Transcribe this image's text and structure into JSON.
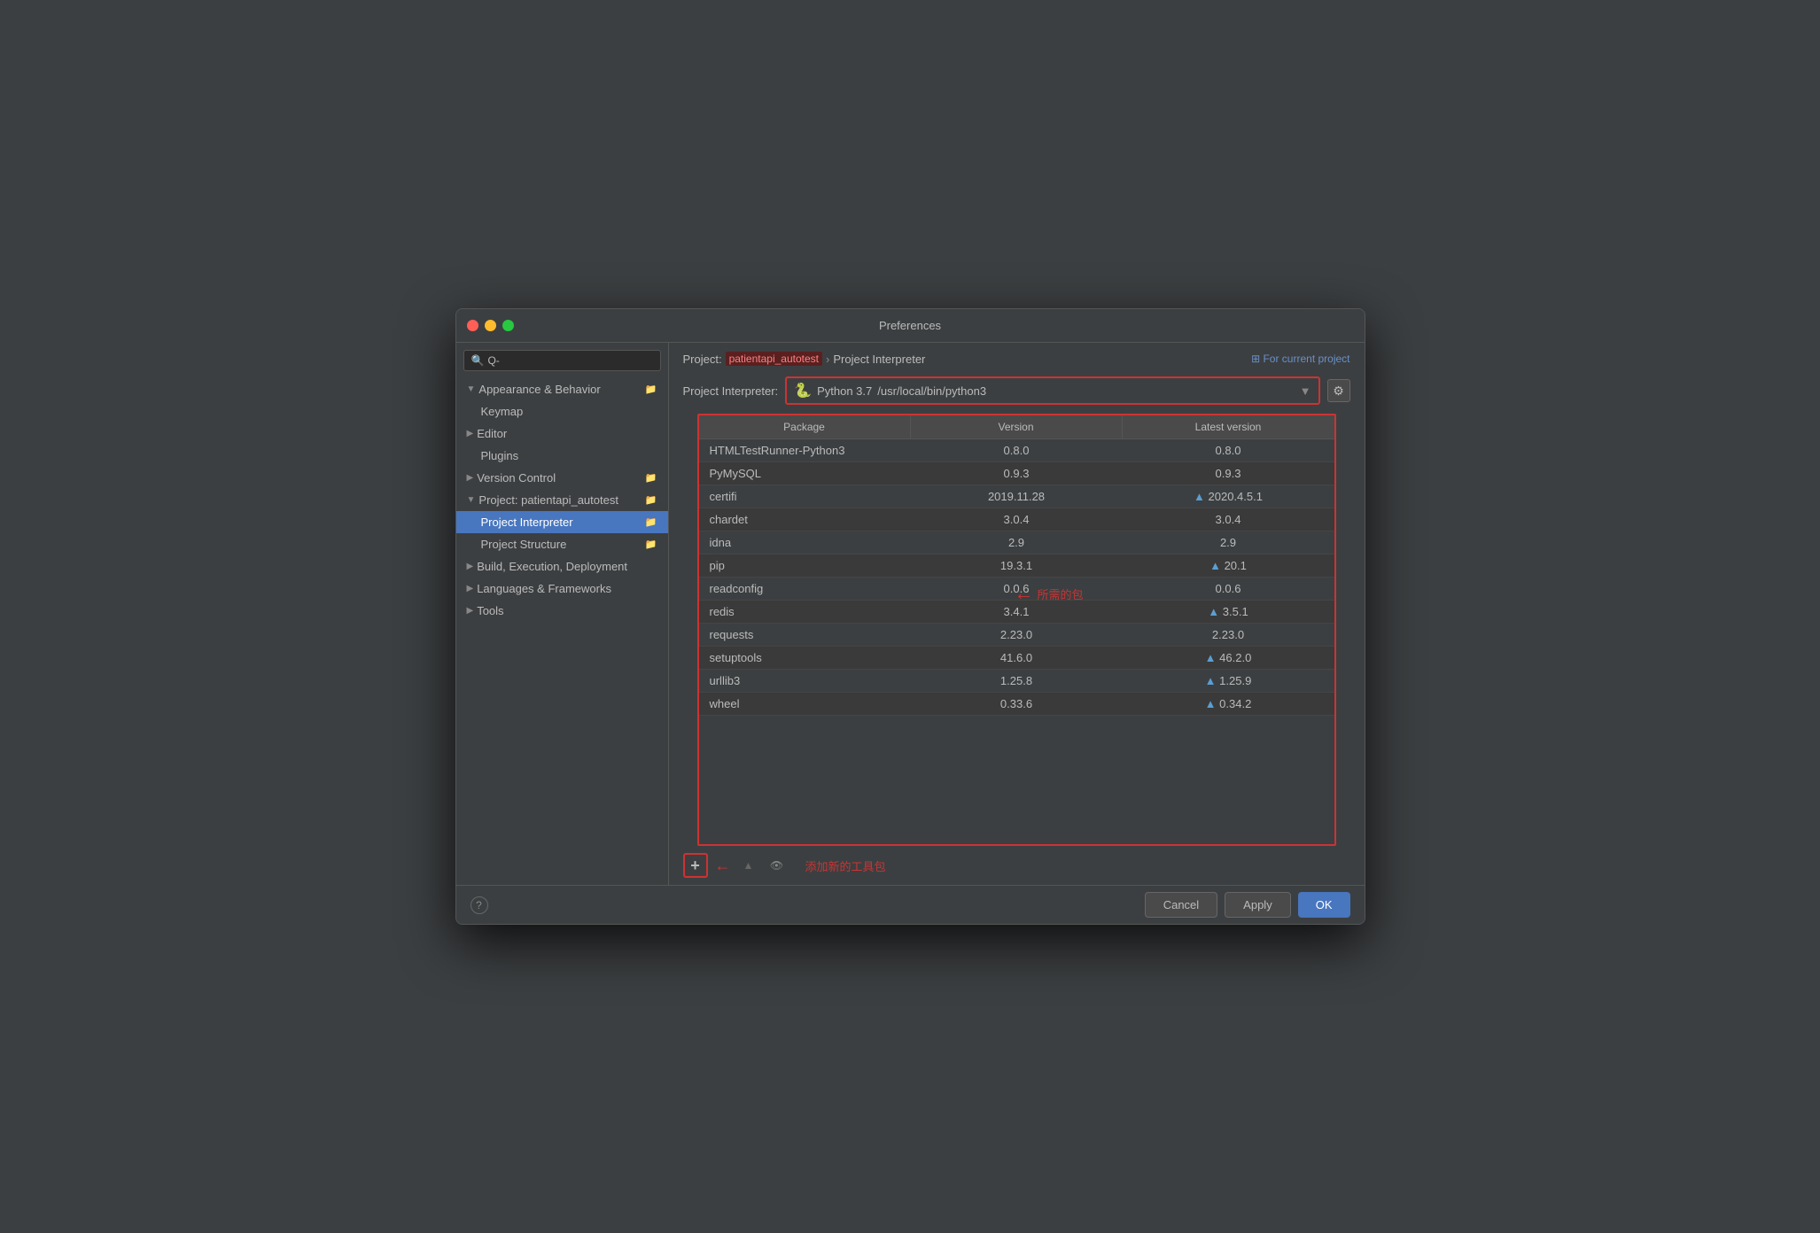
{
  "window": {
    "title": "Preferences"
  },
  "sidebar": {
    "search_placeholder": "Q-",
    "items": [
      {
        "id": "appearance-behavior",
        "label": "Appearance & Behavior",
        "level": 0,
        "expandable": true,
        "expanded": true
      },
      {
        "id": "keymap",
        "label": "Keymap",
        "level": 1
      },
      {
        "id": "editor",
        "label": "Editor",
        "level": 0,
        "expandable": true
      },
      {
        "id": "plugins",
        "label": "Plugins",
        "level": 1
      },
      {
        "id": "version-control",
        "label": "Version Control",
        "level": 0,
        "expandable": true
      },
      {
        "id": "project",
        "label": "Project: patientapi_autotest",
        "level": 0,
        "expandable": true,
        "expanded": true
      },
      {
        "id": "project-interpreter",
        "label": "Project Interpreter",
        "level": 1,
        "active": true
      },
      {
        "id": "project-structure",
        "label": "Project Structure",
        "level": 1
      },
      {
        "id": "build-execution",
        "label": "Build, Execution, Deployment",
        "level": 0,
        "expandable": true
      },
      {
        "id": "languages-frameworks",
        "label": "Languages & Frameworks",
        "level": 0,
        "expandable": true
      },
      {
        "id": "tools",
        "label": "Tools",
        "level": 0,
        "expandable": true
      }
    ]
  },
  "header": {
    "project_label": "Project:",
    "project_name": "patientapi_autotest",
    "arrow": "›",
    "page_title": "Project Interpreter",
    "for_current": "⊞ For current project"
  },
  "interpreter": {
    "label": "Project Interpreter:",
    "icon": "🐍",
    "version": "Python 3.7",
    "path": "/usr/local/bin/python3"
  },
  "table": {
    "columns": [
      "Package",
      "Version",
      "Latest version"
    ],
    "rows": [
      {
        "package": "HTMLTestRunner-Python3",
        "version": "0.8.0",
        "latest": "0.8.0",
        "upgrade": false
      },
      {
        "package": "PyMySQL",
        "version": "0.9.3",
        "latest": "0.9.3",
        "upgrade": false
      },
      {
        "package": "certifi",
        "version": "2019.11.28",
        "latest": "2020.4.5.1",
        "upgrade": true
      },
      {
        "package": "chardet",
        "version": "3.0.4",
        "latest": "3.0.4",
        "upgrade": false
      },
      {
        "package": "idna",
        "version": "2.9",
        "latest": "2.9",
        "upgrade": false
      },
      {
        "package": "pip",
        "version": "19.3.1",
        "latest": "20.1",
        "upgrade": true
      },
      {
        "package": "readconfig",
        "version": "0.0.6",
        "latest": "0.0.6",
        "upgrade": false
      },
      {
        "package": "redis",
        "version": "3.4.1",
        "latest": "3.5.1",
        "upgrade": true
      },
      {
        "package": "requests",
        "version": "2.23.0",
        "latest": "2.23.0",
        "upgrade": false
      },
      {
        "package": "setuptools",
        "version": "41.6.0",
        "latest": "46.2.0",
        "upgrade": true
      },
      {
        "package": "urllib3",
        "version": "1.25.8",
        "latest": "1.25.9",
        "upgrade": true
      },
      {
        "package": "wheel",
        "version": "0.33.6",
        "latest": "0.34.2",
        "upgrade": true
      }
    ]
  },
  "annotations": {
    "packages_needed": "所需的包",
    "add_new_package": "添加新的工具包"
  },
  "toolbar": {
    "add_label": "+",
    "up_label": "▲",
    "eye_label": "👁"
  },
  "footer": {
    "cancel_label": "Cancel",
    "apply_label": "Apply",
    "ok_label": "OK",
    "help_label": "?"
  }
}
